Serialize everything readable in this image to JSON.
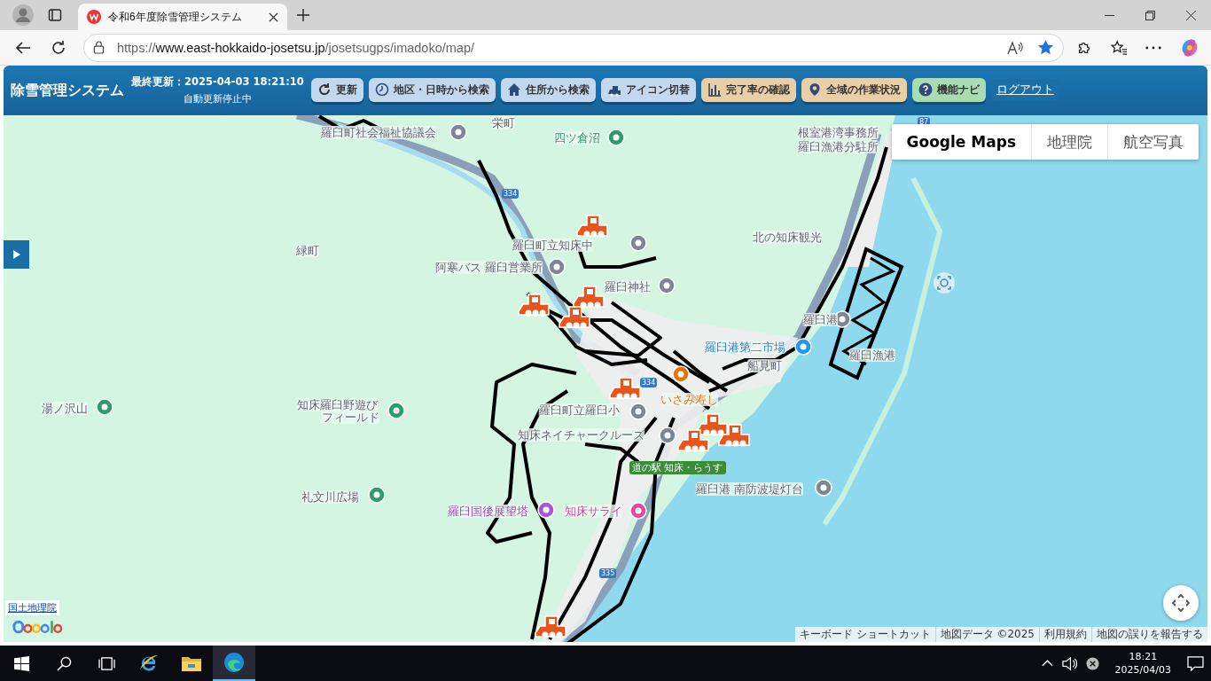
{
  "browser": {
    "tab_title": "令和6年度除雪管理システム",
    "url": "https://www.east-hokkaido-josetsu.jp/josetsugps/imadoko/map/"
  },
  "header": {
    "title": "除雪管理システム",
    "last_updated": "最終更新：2025-04-03 18:21:10",
    "auto_update": "自動更新停止中",
    "buttons": [
      {
        "label": "更新",
        "kind": "button",
        "color": "#c3d8ee"
      },
      {
        "label": "地区・日時から検索",
        "kind": "button",
        "color": "#c3d8ee"
      },
      {
        "label": "住所から検索",
        "kind": "button",
        "color": "#c3d8ee"
      },
      {
        "label": "アイコン切替",
        "kind": "button",
        "color": "#c3d8ee"
      },
      {
        "label": "完了率の確認",
        "kind": "button",
        "color": "#e8cfa8"
      },
      {
        "label": "全域の作業状況",
        "kind": "button",
        "color": "#e8cfa8"
      },
      {
        "label": "機能ナビ",
        "kind": "button",
        "color": "#a9dcb3"
      },
      {
        "label": "ログアウト",
        "kind": "link",
        "color": "#1a6fa6"
      }
    ]
  },
  "map": {
    "map_types": [
      {
        "label": "Google Maps",
        "selected": true
      },
      {
        "label": "地理院",
        "selected": false
      },
      {
        "label": "航空写真",
        "selected": false
      }
    ],
    "labels": [
      {
        "text": "栄町",
        "kind": "place"
      },
      {
        "text": "羅臼町社会福祉協議会",
        "kind": "place"
      },
      {
        "text": "四ツ倉沼",
        "kind": "park"
      },
      {
        "text": "根室港湾事務所",
        "kind": "place"
      },
      {
        "text": "羅臼漁港分駐所",
        "kind": "place"
      },
      {
        "text": "緑町",
        "kind": "place"
      },
      {
        "text": "羅臼町立知床中",
        "kind": "place"
      },
      {
        "text": "北の知床観光",
        "kind": "place"
      },
      {
        "text": "阿寒バス 羅臼営業所",
        "kind": "place"
      },
      {
        "text": "羅臼神社",
        "kind": "place"
      },
      {
        "text": "羅臼港",
        "kind": "place"
      },
      {
        "text": "羅臼港第二市場",
        "kind": "shop"
      },
      {
        "text": "羅臼漁港",
        "kind": "place"
      },
      {
        "text": "船見町",
        "kind": "place"
      },
      {
        "text": "いさみ寿し",
        "kind": "food"
      },
      {
        "text": "湯ノ沢山",
        "kind": "place"
      },
      {
        "text": "知床羅臼野遊び",
        "kind": "place"
      },
      {
        "text": "フィールド",
        "kind": "place"
      },
      {
        "text": "羅臼町立羅臼小",
        "kind": "place"
      },
      {
        "text": "知床ネイチャークルーズ",
        "kind": "place"
      },
      {
        "text": "道の駅 知床・らうす",
        "kind": "station"
      },
      {
        "text": "羅臼港 南防波堤灯台",
        "kind": "place"
      },
      {
        "text": "礼文川広場",
        "kind": "place"
      },
      {
        "text": "羅臼国後展望塔",
        "kind": "tower"
      },
      {
        "text": "知床サライ",
        "kind": "mall"
      }
    ],
    "route_shields": [
      "334",
      "334",
      "335",
      "87"
    ],
    "attribution_link": "国土地理院",
    "footer": [
      "キーボード ショートカット",
      "地図データ ©2025",
      "利用規約",
      "地図の誤りを報告する"
    ]
  },
  "taskbar": {
    "time": "18:21",
    "date": "2025/04/03"
  }
}
